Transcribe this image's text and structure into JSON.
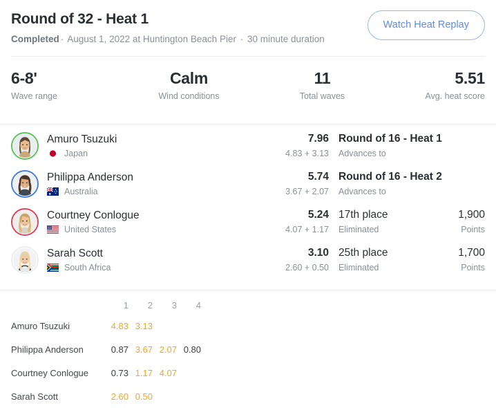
{
  "header": {
    "title": "Round of 32 - Heat 1",
    "status": "Completed",
    "sep1": "·",
    "date_location": "August 1, 2022 at Huntington Beach Pier",
    "sep2": "·",
    "duration": "30 minute duration",
    "replay_button": "Watch Heat Replay"
  },
  "stats": [
    {
      "value": "6-8'",
      "label": "Wave range"
    },
    {
      "value": "Calm",
      "label": "Wind conditions"
    },
    {
      "value": "11",
      "label": "Total waves"
    },
    {
      "value": "5.51",
      "label": "Avg. heat score"
    }
  ],
  "surfers": [
    {
      "name": "Amuro Tsuzuki",
      "country": "Japan",
      "flag": "flag-japan-icon",
      "ring_color": "#5cc45f",
      "total": "7.96",
      "parts": "4.83 + 3.13",
      "result": "Round of 16 - Heat 1",
      "result_sub": "Advances to",
      "points": "",
      "points_label": "",
      "has_points": false
    },
    {
      "name": "Philippa Anderson",
      "country": "Australia",
      "flag": "flag-australia-icon",
      "ring_color": "#4a7fe0",
      "total": "5.74",
      "parts": "3.67 + 2.07",
      "result": "Round of 16 - Heat 2",
      "result_sub": "Advances to",
      "points": "",
      "points_label": "",
      "has_points": false
    },
    {
      "name": "Courtney Conlogue",
      "country": "United States",
      "flag": "flag-united-states-icon",
      "ring_color": "#e0445e",
      "total": "5.24",
      "parts": "4.07 + 1.17",
      "result": "17th place",
      "result_sub": "Eliminated",
      "points": "1,900",
      "points_label": "Points",
      "has_points": true
    },
    {
      "name": "Sarah Scott",
      "country": "South Africa",
      "flag": "flag-south-africa-icon",
      "ring_color": "#eceef0",
      "total": "3.10",
      "parts": "2.60 + 0.50",
      "result": "25th place",
      "result_sub": "Eliminated",
      "points": "1,700",
      "points_label": "Points",
      "has_points": true
    }
  ],
  "wave_table": {
    "columns": [
      "1",
      "2",
      "3",
      "4"
    ],
    "rows": [
      {
        "name": "Amuro Tsuzuki",
        "scores": [
          {
            "value": "4.83",
            "counting": true
          },
          {
            "value": "3.13",
            "counting": true
          },
          {
            "value": "",
            "counting": false
          },
          {
            "value": "",
            "counting": false
          }
        ]
      },
      {
        "name": "Philippa Anderson",
        "scores": [
          {
            "value": "0.87",
            "counting": false
          },
          {
            "value": "3.67",
            "counting": true
          },
          {
            "value": "2.07",
            "counting": true
          },
          {
            "value": "0.80",
            "counting": false
          }
        ]
      },
      {
        "name": "Courtney Conlogue",
        "scores": [
          {
            "value": "0.73",
            "counting": false
          },
          {
            "value": "1.17",
            "counting": true
          },
          {
            "value": "4.07",
            "counting": true
          },
          {
            "value": "",
            "counting": false
          }
        ]
      },
      {
        "name": "Sarah Scott",
        "scores": [
          {
            "value": "2.60",
            "counting": true
          },
          {
            "value": "0.50",
            "counting": true
          },
          {
            "value": "",
            "counting": false
          },
          {
            "value": "",
            "counting": false
          }
        ]
      }
    ]
  },
  "colors": {
    "accent_link": "#5d8bf0",
    "counting_score": "#f5a623",
    "text_primary": "#2b2f33",
    "text_muted": "#8a9097",
    "divider": "#ececef"
  }
}
